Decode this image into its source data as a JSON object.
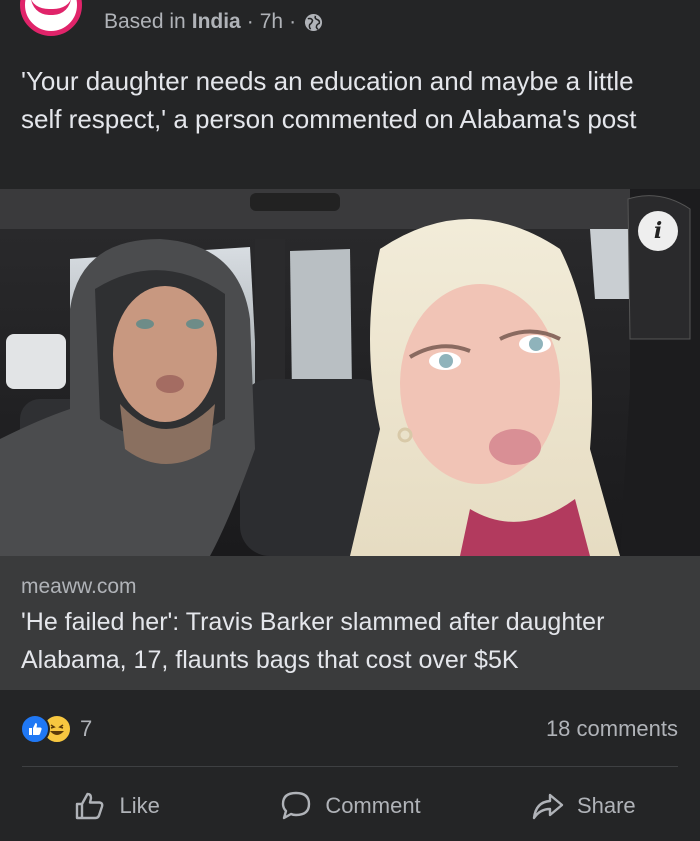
{
  "post": {
    "location_prefix": "Based in",
    "location": "India",
    "time": "7h",
    "separator": "·",
    "text": "'Your daughter needs an education and maybe a little self respect,' a person commented on Alabama's post"
  },
  "link_preview": {
    "domain": "meaww.com",
    "headline": "'He failed her': Travis Barker slammed after daughter Alabama, 17, flaunts bags that cost over $5K",
    "info_icon": "i"
  },
  "stats": {
    "reaction_icons": [
      "like-icon",
      "haha-icon"
    ],
    "reaction_count": "7",
    "comments": "18 comments"
  },
  "actions": {
    "like": "Like",
    "comment": "Comment",
    "share": "Share"
  },
  "colors": {
    "background": "#242526",
    "card": "#3a3b3c",
    "text": "#e4e6eb",
    "muted": "#b0b3b8",
    "like_blue": "#2078f4",
    "avatar_pink": "#e0246a"
  }
}
